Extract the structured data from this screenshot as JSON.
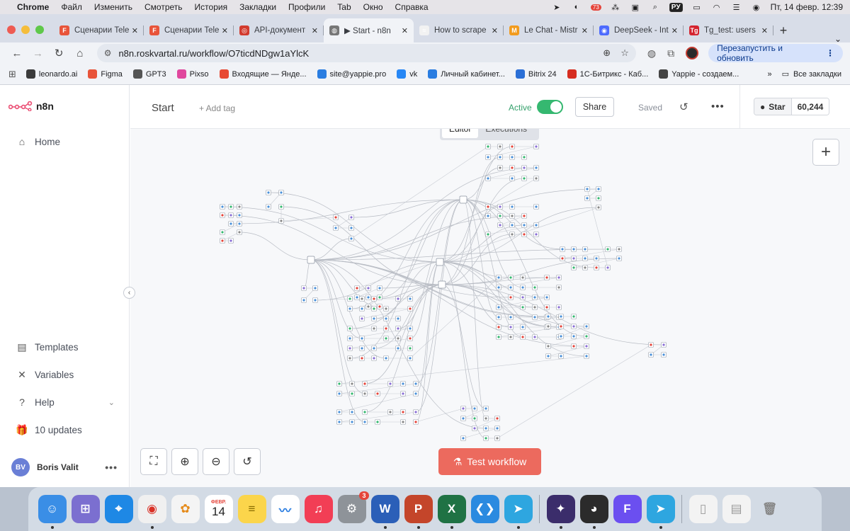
{
  "menubar": {
    "items": [
      "Chrome",
      "Файл",
      "Изменить",
      "Смотреть",
      "История",
      "Закладки",
      "Профили",
      "Tab",
      "Окно",
      "Справка"
    ],
    "badge": "73",
    "lang": "РУ",
    "datetime": "Пт, 14 февр.  12:39"
  },
  "tabs": [
    {
      "title": "Сценарии Tele",
      "color": "#e8543a",
      "glyph": "F"
    },
    {
      "title": "Сценарии Tele",
      "color": "#e8543a",
      "glyph": "F"
    },
    {
      "title": "API-документ",
      "color": "#d23b2e",
      "glyph": "◎"
    },
    {
      "title": "▶ Start - n8n",
      "color": "#777777",
      "glyph": "◍"
    },
    {
      "title": "How to scrape",
      "color": "#f2f2f2",
      "glyph": "≈"
    },
    {
      "title": "Le Chat - Mistr",
      "color": "#f29b1e",
      "glyph": "M"
    },
    {
      "title": "DeepSeek - Int",
      "color": "#4d6bfe",
      "glyph": "◉"
    },
    {
      "title": "Tg_test: users",
      "color": "#d4242f",
      "glyph": "Tg"
    }
  ],
  "toolbar": {
    "url": "n8n.roskvartal.ru/workflow/O7ticdNDgw1aYlcK",
    "relaunch": "Перезапустить и обновить"
  },
  "bookmarks": [
    {
      "label": "leonardo.ai",
      "color": "#3b3b3b"
    },
    {
      "label": "Figma",
      "color": "#e8543a"
    },
    {
      "label": "GPT3",
      "color": "#555555"
    },
    {
      "label": "Pixso",
      "color": "#e0479e"
    },
    {
      "label": "Входящие — Янде...",
      "color": "#e74a33"
    },
    {
      "label": "site@yappie.pro",
      "color": "#2a7de1"
    },
    {
      "label": "vk",
      "color": "#2787f5"
    },
    {
      "label": "Личный кабинет...",
      "color": "#2a7de1"
    },
    {
      "label": "Bitrix 24",
      "color": "#2b6fd6"
    },
    {
      "label": "1С-Битрикс - Каб...",
      "color": "#d62d20"
    },
    {
      "label": "Yappie - создаем...",
      "color": "#444444"
    }
  ],
  "bookmarks_all": "Все закладки",
  "app": {
    "logo": "n8n",
    "sidebar": {
      "home": "Home",
      "templates": "Templates",
      "variables": "Variables",
      "help": "Help",
      "updates": "10 updates"
    },
    "user": {
      "initials": "BV",
      "name": "Boris Valit"
    },
    "header": {
      "workflow_name": "Start",
      "add_tag": "+ Add tag",
      "active": "Active",
      "share": "Share",
      "saved": "Saved"
    },
    "github": {
      "star": "Star",
      "count": "60,244"
    },
    "modes": {
      "editor": "Editor",
      "executions": "Executions"
    },
    "test_button": "Test workflow"
  },
  "dock": {
    "calendar_month": "ФЕВР.",
    "calendar_day": "14",
    "settings_badge": "3"
  },
  "colors": {
    "accent": "#ec6a5e",
    "active_green": "#35b870",
    "canvas_bg": "#f7f8fa"
  }
}
